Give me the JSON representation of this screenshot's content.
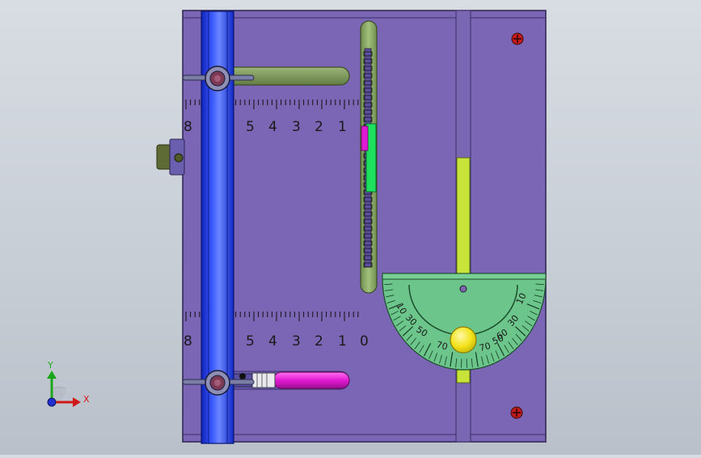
{
  "scale_top": {
    "labels": [
      "8",
      "5",
      "4",
      "3",
      "2",
      "1"
    ]
  },
  "scale_bottom": {
    "labels": [
      "8",
      "5",
      "4",
      "3",
      "2",
      "1",
      "0"
    ]
  },
  "protractor": {
    "left_labels": [
      "10",
      "30",
      "50",
      "70"
    ],
    "right_labels": [
      "70",
      "50",
      "60",
      "30",
      "10"
    ]
  },
  "triad": {
    "x_label": "X",
    "y_label": "Y"
  },
  "colors": {
    "background": "#cdd3da",
    "plate": "#7b66b5",
    "rail_blue": "#1e38d8",
    "slot_green": "#7d9a5a",
    "protractor_green": "#6cc58a",
    "knob_yellow": "#f2e21a",
    "magenta": "#e21ad2",
    "yellow_green": "#c8e43a"
  }
}
